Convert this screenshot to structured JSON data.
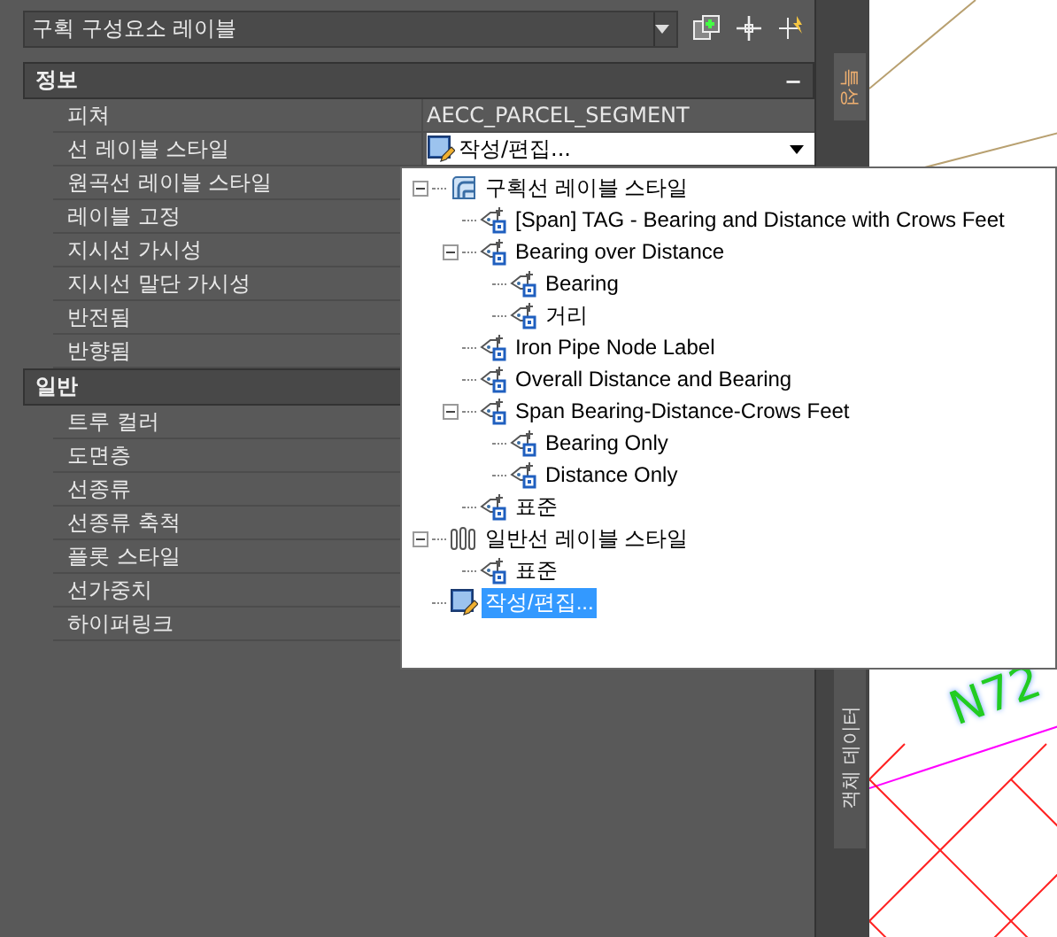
{
  "palette": {
    "selector": {
      "value": "구획 구성요소 레이블"
    },
    "sections": [
      {
        "title": "정보",
        "collapse_glyph": "−",
        "rows": [
          {
            "name": "피쳐",
            "value": "AECC_PARCEL_SEGMENT",
            "kind": "text"
          },
          {
            "name": "선 레이블 스타일",
            "value": "작성/편집...",
            "kind": "dropdown"
          },
          {
            "name": "원곡선 레이블 스타일"
          },
          {
            "name": "레이블 고정"
          },
          {
            "name": "지시선 가시성"
          },
          {
            "name": "지시선 말단 가시성"
          },
          {
            "name": "반전됨"
          },
          {
            "name": "반향됨"
          }
        ]
      },
      {
        "title": "일반",
        "rows": [
          {
            "name": "트루 컬러"
          },
          {
            "name": "도면층"
          },
          {
            "name": "선종류"
          },
          {
            "name": "선종류 축척"
          },
          {
            "name": "플롯 스타일"
          },
          {
            "name": "선가중치"
          },
          {
            "name": "하이퍼링크"
          }
        ]
      }
    ]
  },
  "side_tabs": [
    {
      "label": "특성",
      "selected": true
    },
    {
      "label": "객체 데이터",
      "selected": false
    }
  ],
  "drawing": {
    "label": "N72"
  },
  "dropdown_tree": [
    {
      "label": "구획선 레이블 스타일",
      "kind": "group",
      "expanded": true,
      "selected": false,
      "children": [
        {
          "label": "[Span] TAG - Bearing and Distance with Crows Feet",
          "kind": "style",
          "selected": false
        },
        {
          "label": "Bearing over Distance",
          "kind": "style",
          "expanded": true,
          "selected": false,
          "children": [
            {
              "label": "Bearing",
              "kind": "style",
              "selected": false
            },
            {
              "label": "거리",
              "kind": "style",
              "selected": false
            }
          ]
        },
        {
          "label": "Iron Pipe Node Label",
          "kind": "style",
          "selected": false
        },
        {
          "label": "Overall Distance and Bearing",
          "kind": "style",
          "selected": false
        },
        {
          "label": "Span Bearing-Distance-Crows Feet",
          "kind": "style",
          "expanded": true,
          "selected": false,
          "children": [
            {
              "label": "Bearing Only",
              "kind": "style",
              "selected": false
            },
            {
              "label": "Distance Only",
              "kind": "style",
              "selected": false
            }
          ]
        },
        {
          "label": "표준",
          "kind": "style",
          "selected": false
        }
      ]
    },
    {
      "label": "일반선 레이블 스타일",
      "kind": "general",
      "expanded": true,
      "selected": false,
      "children": [
        {
          "label": "표준",
          "kind": "style",
          "selected": false
        }
      ]
    },
    {
      "label": "작성/편집...",
      "kind": "edit",
      "selected": true
    }
  ]
}
